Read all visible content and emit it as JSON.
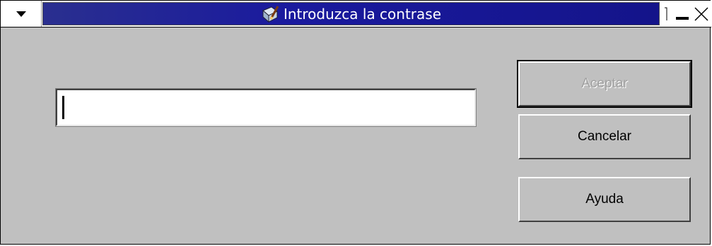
{
  "window": {
    "title": "Introduzca la contrase",
    "colors": {
      "title_bar": "#1a1a9e",
      "title_text": "#ffffff",
      "face": "#c0c0c0"
    },
    "icons": {
      "menu": "down-triangle-icon",
      "app": "document-pen-icon",
      "restore": "restore-icon",
      "minimize": "minimize-icon",
      "close": "close-icon"
    }
  },
  "password_field": {
    "value": ""
  },
  "buttons": {
    "accept": "Aceptar",
    "cancel": "Cancelar",
    "help": "Ayuda"
  }
}
